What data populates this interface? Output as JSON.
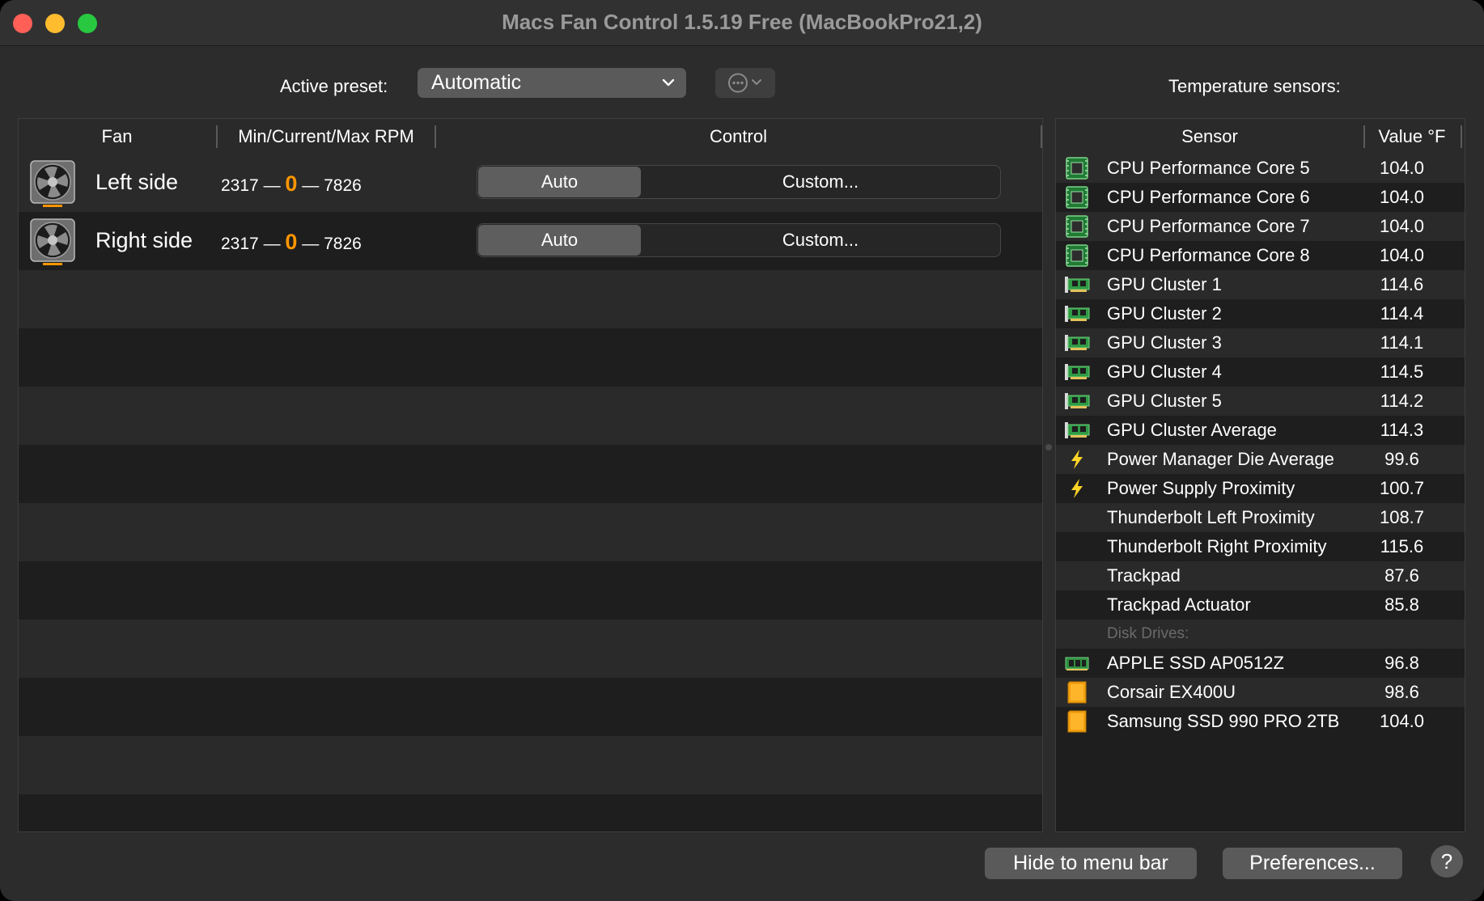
{
  "window": {
    "title": "Macs Fan Control 1.5.19 Free (MacBookPro21,2)"
  },
  "preset": {
    "label": "Active preset:",
    "value": "Automatic"
  },
  "sensors_label": "Temperature sensors:",
  "fans": {
    "headers": {
      "fan": "Fan",
      "rpm": "Min/Current/Max RPM",
      "control": "Control"
    },
    "rows": [
      {
        "name": "Left side",
        "min": "2317",
        "current": "0",
        "max": "7826",
        "auto_label": "Auto",
        "custom_label": "Custom...",
        "separator": "—"
      },
      {
        "name": "Right side",
        "min": "2317",
        "current": "0",
        "max": "7826",
        "auto_label": "Auto",
        "custom_label": "Custom...",
        "separator": "—"
      }
    ]
  },
  "sensors": {
    "headers": {
      "sensor": "Sensor",
      "value": "Value °F"
    },
    "rows": [
      {
        "icon": "cpu-chip-icon",
        "name": "CPU Performance Core 5",
        "value": "104.0"
      },
      {
        "icon": "cpu-chip-icon",
        "name": "CPU Performance Core 6",
        "value": "104.0"
      },
      {
        "icon": "cpu-chip-icon",
        "name": "CPU Performance Core 7",
        "value": "104.0"
      },
      {
        "icon": "cpu-chip-icon",
        "name": "CPU Performance Core 8",
        "value": "104.0"
      },
      {
        "icon": "gpu-card-icon",
        "name": "GPU Cluster 1",
        "value": "114.6"
      },
      {
        "icon": "gpu-card-icon",
        "name": "GPU Cluster 2",
        "value": "114.4"
      },
      {
        "icon": "gpu-card-icon",
        "name": "GPU Cluster 3",
        "value": "114.1"
      },
      {
        "icon": "gpu-card-icon",
        "name": "GPU Cluster 4",
        "value": "114.5"
      },
      {
        "icon": "gpu-card-icon",
        "name": "GPU Cluster 5",
        "value": "114.2"
      },
      {
        "icon": "gpu-card-icon",
        "name": "GPU Cluster Average",
        "value": "114.3"
      },
      {
        "icon": "lightning-icon",
        "name": "Power Manager Die Average",
        "value": "99.6"
      },
      {
        "icon": "lightning-icon",
        "name": "Power Supply Proximity",
        "value": "100.7"
      },
      {
        "icon": "",
        "name": "Thunderbolt Left Proximity",
        "value": "108.7"
      },
      {
        "icon": "",
        "name": "Thunderbolt Right Proximity",
        "value": "115.6"
      },
      {
        "icon": "",
        "name": "Trackpad",
        "value": "87.6"
      },
      {
        "icon": "",
        "name": "Trackpad Actuator",
        "value": "85.8"
      },
      {
        "group": "Disk Drives:"
      },
      {
        "icon": "ssd-module-icon",
        "name": "APPLE SSD AP0512Z",
        "value": "96.8"
      },
      {
        "icon": "disk-drive-icon",
        "name": "Corsair EX400U",
        "value": "98.6"
      },
      {
        "icon": "disk-drive-icon",
        "name": "Samsung SSD 990 PRO 2TB",
        "value": "104.0"
      }
    ]
  },
  "footer": {
    "hide_label": "Hide to menu bar",
    "prefs_label": "Preferences...",
    "help_label": "?"
  },
  "colors": {
    "accent_orange": "#ff9500",
    "window_bg": "#2c2c2c",
    "panel_bg": "#1e1e1e",
    "row_alt": "#2a2a2a"
  }
}
